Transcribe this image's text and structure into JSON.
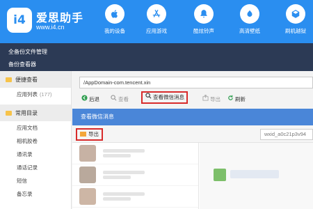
{
  "header": {
    "logo_text": "i4",
    "brand_name": "爱思助手",
    "brand_url": "www.i4.cn",
    "nav": [
      {
        "label": "我的设备",
        "icon": "apple-icon"
      },
      {
        "label": "应用游戏",
        "icon": "app-store-icon"
      },
      {
        "label": "酷炫铃声",
        "icon": "bell-icon"
      },
      {
        "label": "高清壁纸",
        "icon": "wallpaper-icon"
      },
      {
        "label": "刷机越狱",
        "icon": "box-icon"
      }
    ]
  },
  "darkbar": {
    "line1": "全备份文件管理",
    "line2": "备份查看器"
  },
  "sidebar": {
    "sections": [
      {
        "title": "便捷查看",
        "items": [
          {
            "label": "应用列表",
            "count": "(177)"
          }
        ]
      },
      {
        "title": "常用目录",
        "items": [
          {
            "label": "应用文档"
          },
          {
            "label": "相机胶卷"
          },
          {
            "label": "通讯录"
          },
          {
            "label": "通话记录"
          },
          {
            "label": "短信"
          },
          {
            "label": "备忘录"
          }
        ]
      }
    ]
  },
  "main": {
    "path": "/AppDomain-com.tencent.xin",
    "toolbar": {
      "back": "后退",
      "search": "查看",
      "view_wechat": "查看微信消息",
      "export": "导出",
      "refresh": "刷新"
    }
  },
  "dialog": {
    "title": "查看微信消息",
    "export": "导出",
    "wxid": "wxid_a0c21p3v94"
  },
  "colors": {
    "header_blue": "#2a8ef0",
    "dark_bar": "#2c3a55",
    "dialog_head": "#4a86d8",
    "highlight_red": "#d82b2b"
  }
}
